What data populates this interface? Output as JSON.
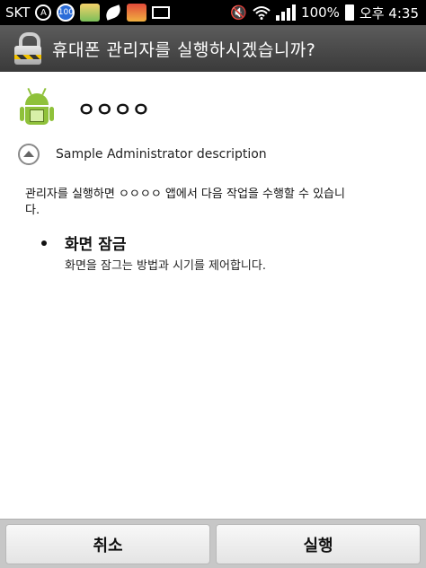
{
  "status_bar": {
    "carrier": "SKT",
    "badge_100": "100",
    "battery_percent": "100%",
    "time": "오후 4:35",
    "icons": [
      "circle-a-icon",
      "badge-100-icon",
      "app-icon",
      "leaf-icon",
      "app2-icon",
      "mail-icon",
      "mute-icon",
      "wifi-icon",
      "signal-icon",
      "battery-icon"
    ]
  },
  "title_bar": {
    "icon": "lock-icon",
    "title": "휴대폰 관리자를 실행하시겠습니까?"
  },
  "app": {
    "icon": "android-icon",
    "name": "ㅇㅇㅇㅇ",
    "description": "Sample Administrator description"
  },
  "warning": "관리자를 실행하면 ㅇㅇㅇㅇ 앱에서 다음 작업을 수행할 수 있습니다.",
  "policies": [
    {
      "title": "화면 잠금",
      "description": "화면을 잠그는 방법과 시기를 제어합니다."
    }
  ],
  "buttons": {
    "cancel": "취소",
    "run": "실행"
  },
  "colors": {
    "title_bar": "#4a4a4a",
    "android_green": "#8fc13a",
    "button_bar": "#c7c7c7"
  }
}
